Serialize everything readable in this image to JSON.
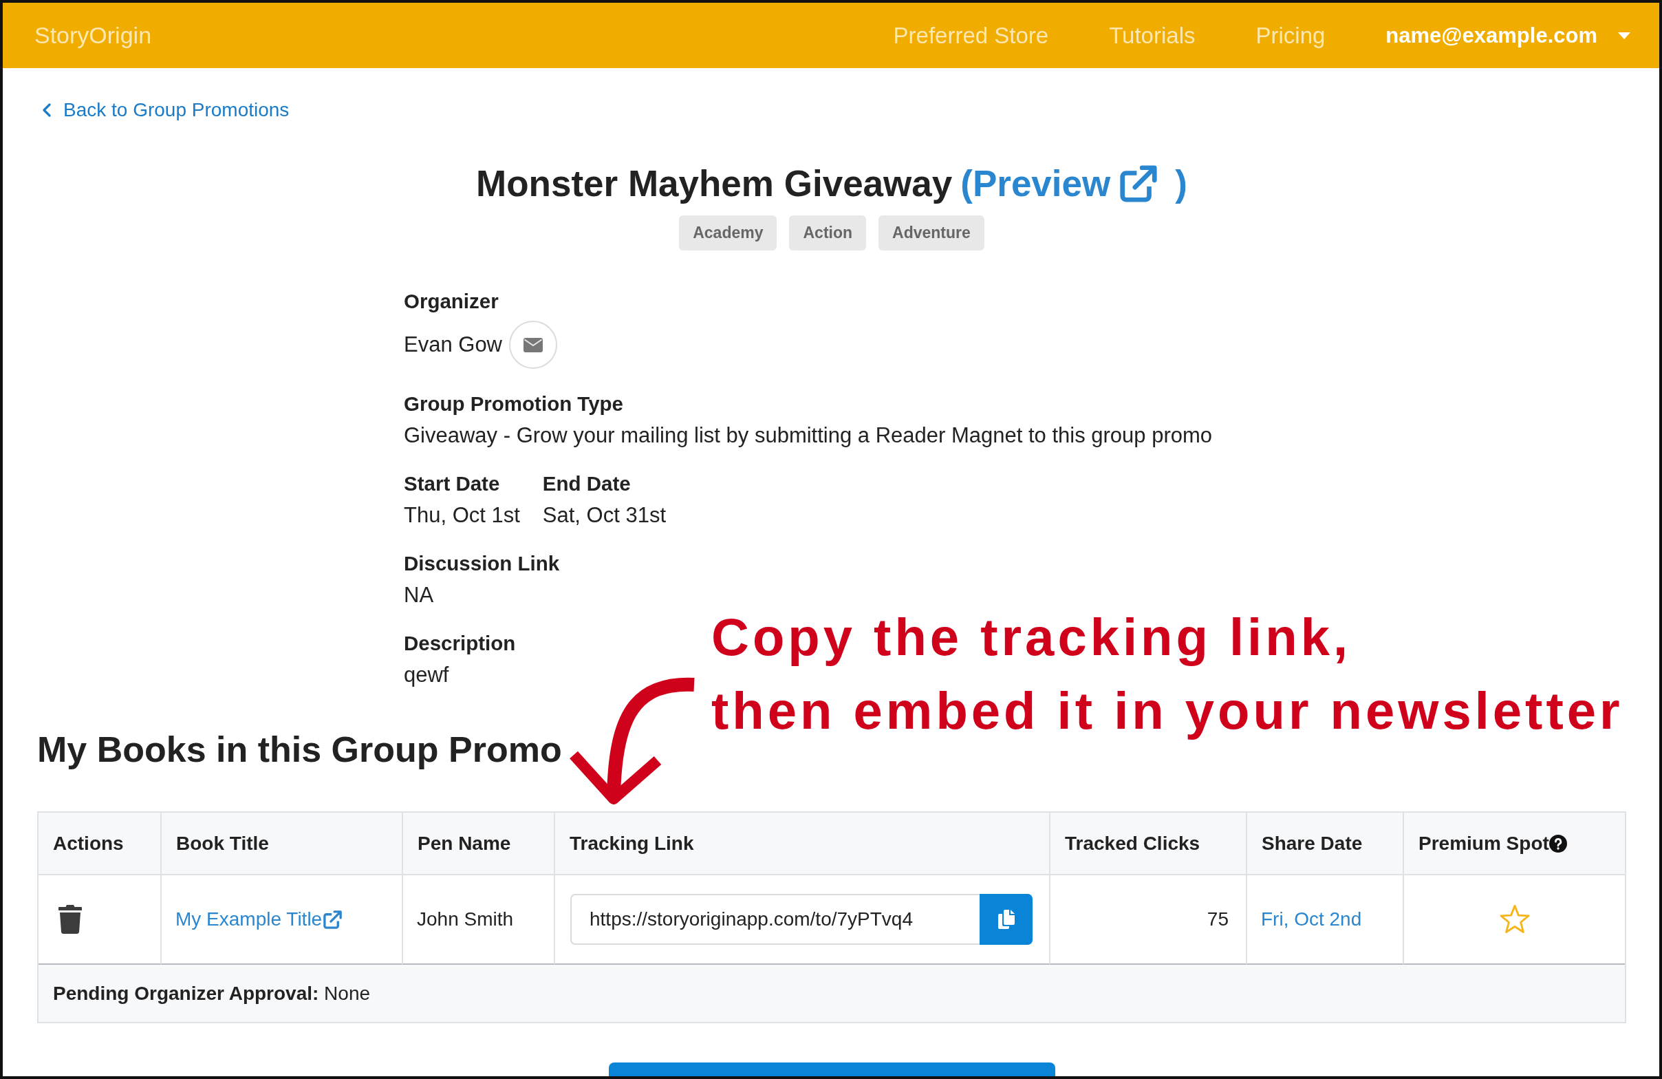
{
  "header": {
    "logo": "StoryOrigin",
    "nav": [
      "Preferred Store",
      "Tutorials",
      "Pricing"
    ],
    "account": "name@example.com"
  },
  "back_link": "Back to Group Promotions",
  "promotion": {
    "title": "Monster Mayhem Giveaway",
    "preview_link": {
      "text": "(Preview",
      "closing": ")"
    },
    "tags": [
      "Academy",
      "Action",
      "Adventure"
    ]
  },
  "details": [
    {
      "kind": "contact",
      "label": "Organizer",
      "value": "Evan Gow"
    },
    {
      "kind": "text",
      "label": "Group Promotion Type",
      "value": "Giveaway - Grow your mailing list by submitting a Reader Magnet to this group promo"
    },
    {
      "kind": "pair",
      "items": [
        {
          "label": "Start Date",
          "value": "Thu, Oct 1st"
        },
        {
          "label": "End Date",
          "value": "Sat, Oct 31st"
        }
      ]
    },
    {
      "kind": "text",
      "label": "Discussion Link",
      "value": "NA"
    },
    {
      "kind": "text",
      "label": "Description",
      "value": "qewf"
    }
  ],
  "books": {
    "title": "My Books in this Group Promo",
    "table": {
      "columns": [
        {
          "label": "Actions",
          "help": false
        },
        {
          "label": "Book Title",
          "help": false
        },
        {
          "label": "Pen Name",
          "help": false
        },
        {
          "label": "Tracking Link",
          "help": false
        },
        {
          "label": "Tracked Clicks",
          "help": false
        },
        {
          "label": "Share Date",
          "help": false
        },
        {
          "label": "Premium Spot",
          "help": true
        }
      ],
      "rows": [
        {
          "book_title": "My Example Title",
          "pen_name": "John Smith",
          "tracking_link": "https://storyoriginapp.com/to/7yPTvq4",
          "tracked_clicks": "75",
          "share_date": "Fri, Oct 2nd",
          "premium": false
        }
      ],
      "footer": "**Pending Organizer Approval:** None"
    }
  },
  "annotation": {
    "lines": [
      "Copy the tracking link,",
      "then embed it in your newsletter"
    ]
  }
}
